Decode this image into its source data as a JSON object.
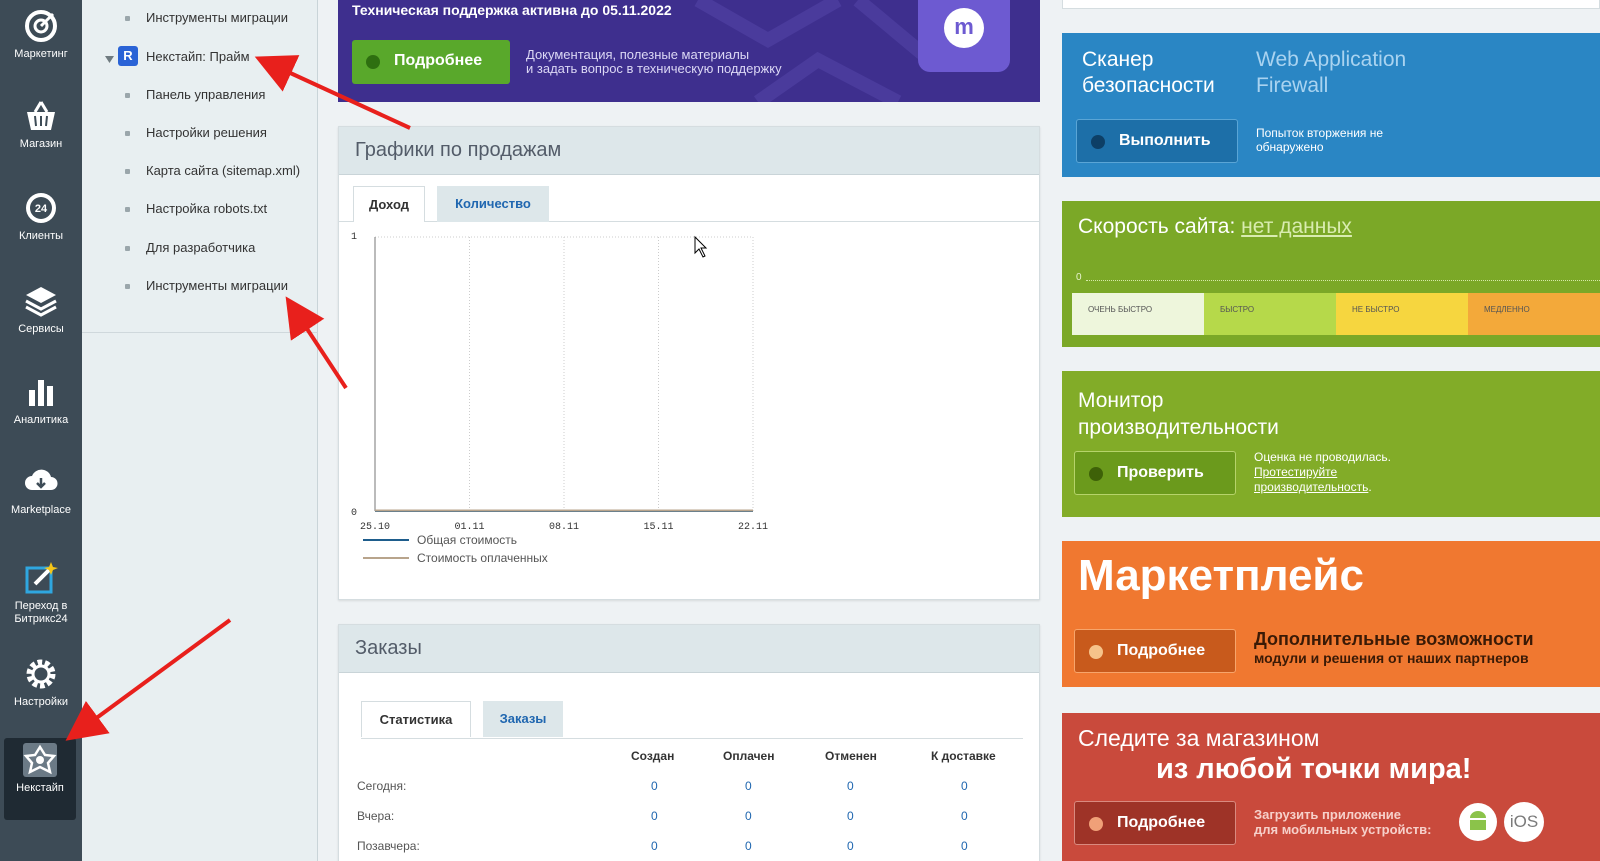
{
  "rail": {
    "items": [
      {
        "label": "Маркетинг"
      },
      {
        "label": "Магазин"
      },
      {
        "label": "Клиенты",
        "badge": "24"
      },
      {
        "label": "Сервисы"
      },
      {
        "label": "Аналитика"
      },
      {
        "label": "Marketplace"
      },
      {
        "label": "Переход в Битрикс24"
      },
      {
        "label": "Настройки"
      },
      {
        "label": "Некстайп"
      }
    ]
  },
  "tree": {
    "items": [
      {
        "label": "Инструменты миграции"
      },
      {
        "label": "Некстайп: Прайм",
        "badge": "R"
      },
      {
        "label": "Панель управления"
      },
      {
        "label": "Настройки решения"
      },
      {
        "label": "Карта сайта (sitemap.xml)"
      },
      {
        "label": "Настройка robots.txt"
      },
      {
        "label": "Для разработчика"
      },
      {
        "label": "Инструменты миграции"
      }
    ]
  },
  "banner": {
    "title": "Техническая поддержка активна до 05.11.2022",
    "button": "Подробнее",
    "desc_line1": "Документация, полезные материалы",
    "desc_line2": "и задать вопрос в техническую поддержку",
    "logo": "m"
  },
  "sales": {
    "title": "Графики по продажам",
    "tabs": [
      "Доход",
      "Количество"
    ],
    "legend": [
      "Общая стоимость",
      "Стоимость оплаченных"
    ]
  },
  "chart_data": {
    "type": "line",
    "x": [
      "25.10",
      "01.11",
      "08.11",
      "15.11",
      "22.11"
    ],
    "series": [
      {
        "name": "Общая стоимость",
        "values": [
          0,
          0,
          0,
          0,
          0
        ],
        "color": "#1e5d8c"
      },
      {
        "name": "Стоимость оплаченных",
        "values": [
          0,
          0,
          0,
          0,
          0
        ],
        "color": "#b8a48c"
      }
    ],
    "ylim": [
      0,
      1
    ],
    "yticks": [
      "0",
      "1"
    ],
    "grid": true,
    "legend_position": "bottom-left"
  },
  "orders": {
    "title": "Заказы",
    "tabs": [
      "Статистика",
      "Заказы"
    ],
    "columns": [
      "Создан",
      "Оплачен",
      "Отменен",
      "К доставке"
    ],
    "rows": [
      {
        "label": "Сегодня:",
        "values": [
          "0",
          "0",
          "0",
          "0"
        ]
      },
      {
        "label": "Вчера:",
        "values": [
          "0",
          "0",
          "0",
          "0"
        ]
      },
      {
        "label": "Позавчера:",
        "values": [
          "0",
          "0",
          "0",
          "0"
        ]
      }
    ]
  },
  "widgets": {
    "scanner": {
      "title_line1": "Сканер",
      "title_line2": "безопасности",
      "waf_line1": "Web Application",
      "waf_line2": "Firewall",
      "button": "Выполнить",
      "status_line1": "Попыток вторжения не",
      "status_line2": "обнаружено"
    },
    "speed": {
      "title": "Скорость сайта:",
      "value": "нет данных",
      "scale_zero": "0",
      "segments": [
        {
          "label": "ОЧЕНЬ БЫСТРО"
        },
        {
          "label": "БЫСТРО"
        },
        {
          "label": "НЕ БЫСТРО"
        },
        {
          "label": "МЕДЛЕННО"
        }
      ]
    },
    "monitor": {
      "title_line1": "Монитор",
      "title_line2": "производительности",
      "button": "Проверить",
      "status_line1": "Оценка не проводилась.",
      "link_line1": "Протестируйте",
      "link_line2": "производительность",
      "period": "."
    },
    "marketplace": {
      "title": "Маркетплейс",
      "button": "Подробнее",
      "desc_line1": "Дополнительные возможности",
      "desc_line2": "модули и решения от наших партнеров"
    },
    "mobile": {
      "title_line1": "Следите за магазином",
      "title_line2": "из любой точки мира!",
      "button": "Подробнее",
      "desc_line1": "Загрузить приложение",
      "desc_line2": "для мобильных устройств:",
      "ios": "iOS"
    }
  },
  "colors": {
    "rail_bg": "#3d4b56",
    "accent_green": "#59a82b",
    "annotation_red": "#e8201c",
    "link_blue": "#2067b0"
  }
}
